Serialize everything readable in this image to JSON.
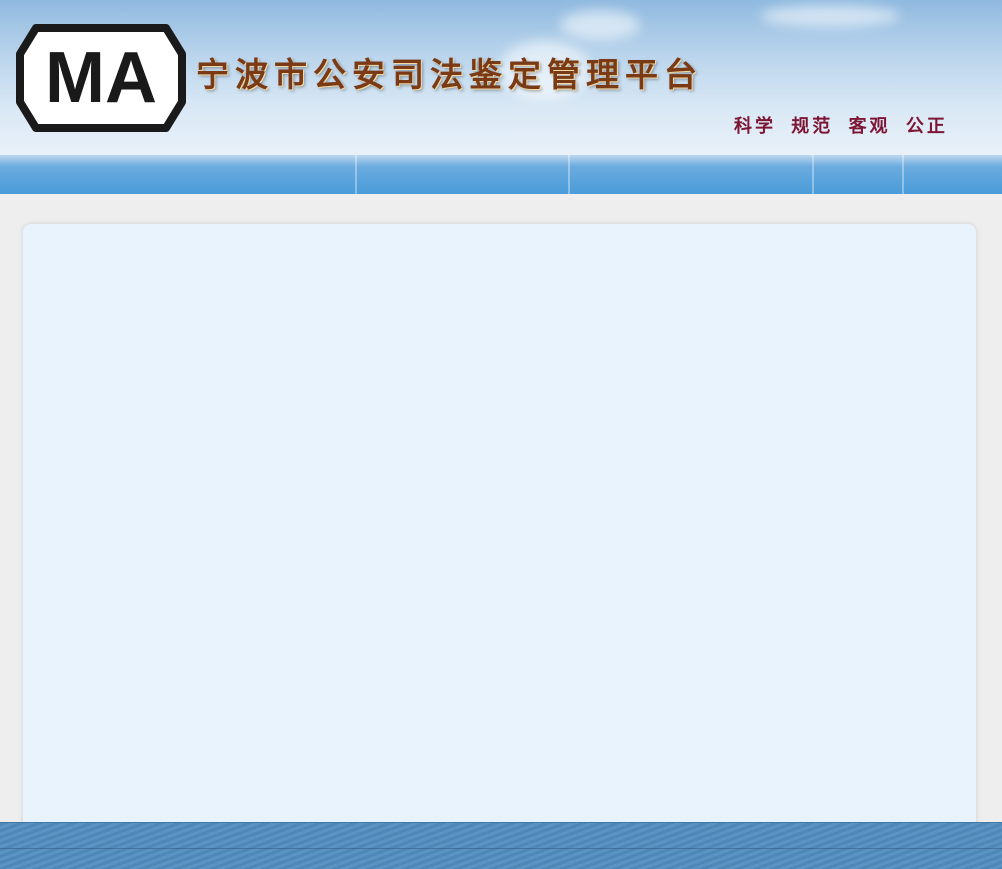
{
  "header": {
    "logo_text": "MA",
    "title": "宁波市公安司法鉴定管理平台",
    "slogan": [
      "科学",
      "规范",
      "客观",
      "公正"
    ],
    "colors": {
      "title": "#7a3a16",
      "slogan": "#7d1634"
    }
  },
  "navbar": {
    "items": []
  },
  "content": {},
  "footer": {}
}
